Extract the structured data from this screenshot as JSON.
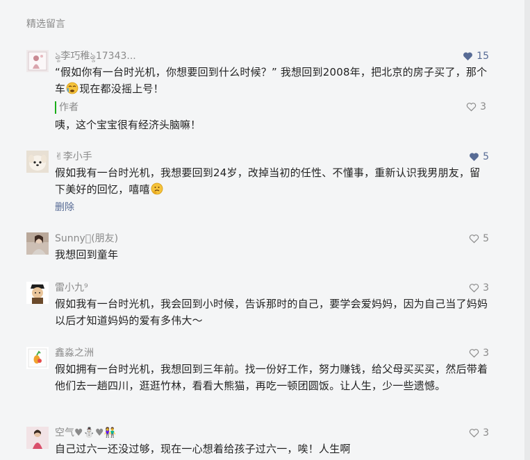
{
  "section_title": "精选留言",
  "colors": {
    "liked": "#576b95",
    "muted": "#8a8a8a",
    "author_bar": "#1aad19"
  },
  "comments": [
    {
      "name": "ৡ李巧稚ৡ17343...",
      "likes": "15",
      "liked": true,
      "text_a": "“假如你有一台时光机，你想要回到什么时候？” 我想回到2008年，把北京的房子买了，那个车",
      "emoji": "crying-face-emoji",
      "text_b": "现在都没摇上号！",
      "reply": {
        "name": "作者",
        "text": "咦，这个宝宝很有经济头脑嘛！",
        "likes": "3"
      }
    },
    {
      "name": "✌李小手",
      "likes": "5",
      "liked": true,
      "text_a": "假如我有一台时光机，我想要回到24岁，改掉当初的任性、不懂事，重新认识我男朋友，留下美好的回忆，嘻嘻",
      "emoji": "thinking-face-emoji",
      "delete_label": "删除"
    },
    {
      "name": "Sunny􏰀(朋友)",
      "likes": "5",
      "liked": false,
      "text_a": "我想回到童年"
    },
    {
      "name": "雷小九⁹",
      "likes": "3",
      "liked": false,
      "text_a": "假如我有一台时光机，我会回到小时候，告诉那时的自己，要学会爱妈妈，因为自己当了妈妈以后才知道妈妈的爱有多伟大～"
    },
    {
      "name": "鑫淼之洲",
      "likes": "3",
      "liked": false,
      "text_a": "假如拥有一台时光机，我想回到三年前。找一份好工作，努力赚钱，给父母买买买，然后带着他们去一趟四川，逛逛竹林，看看大熊猫，再吃一顿团圆饭。让人生，少一些遗憾。"
    },
    {
      "name": "空气♥⛄♥👫",
      "likes": "3",
      "liked": false,
      "text_a": "自己过六一还没过够，现在一心想着给孩子过六一，唉！人生啊"
    }
  ]
}
